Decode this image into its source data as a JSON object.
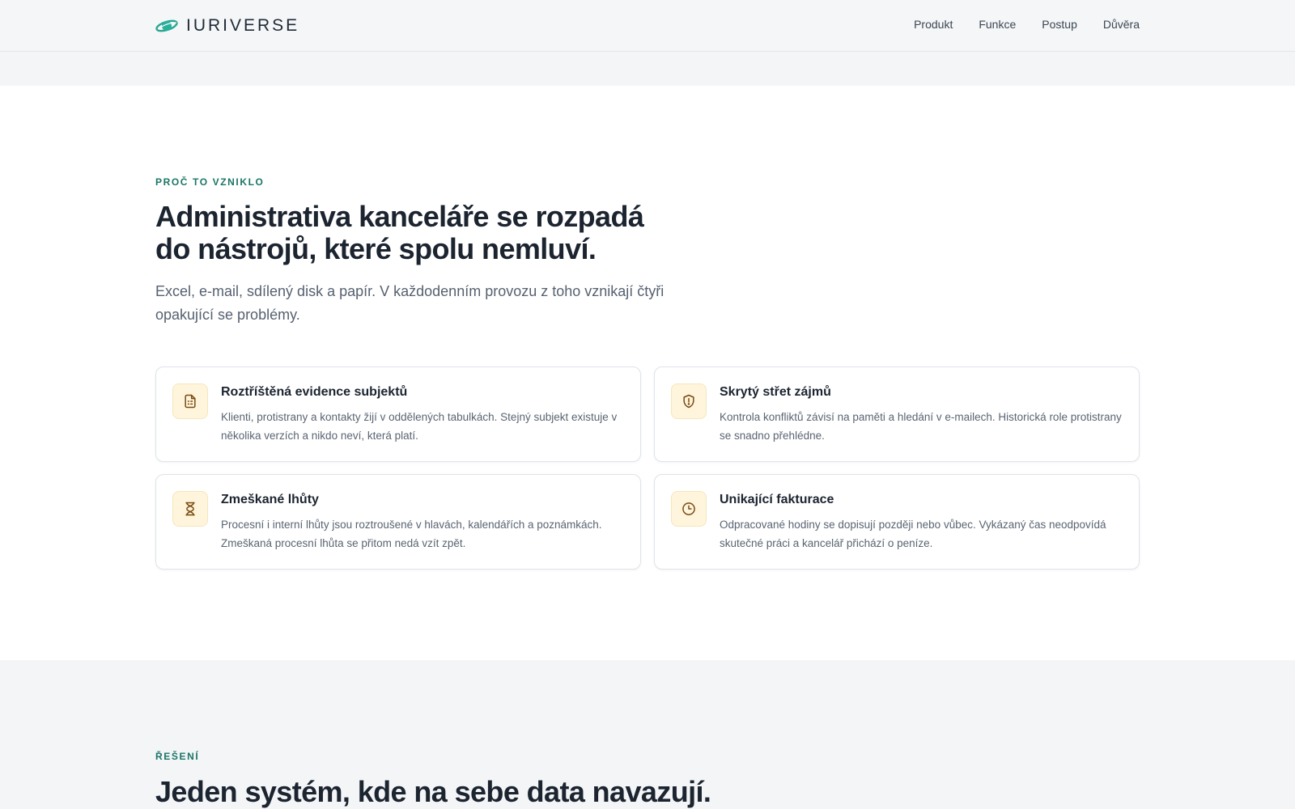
{
  "header": {
    "brand": "IURIVERSE",
    "nav": [
      "Produkt",
      "Funkce",
      "Postup",
      "Důvěra"
    ]
  },
  "problems": {
    "eyebrow": "PROČ TO VZNIKLO",
    "title_line1": "Administrativa kanceláře se rozpadá",
    "title_line2": "do nástrojů, které spolu nemluví.",
    "lead": "Excel, e-mail, sdílený disk a papír. V každodenním provozu z toho vznikají čtyři opakující se problémy.",
    "cards": [
      {
        "icon": "document-icon",
        "title": "Roztříštěná evidence subjektů",
        "desc": "Klienti, protistrany a kontakty žijí v oddělených tabulkách. Stejný subjekt existuje v několika verzích a nikdo neví, která platí."
      },
      {
        "icon": "shield-alert-icon",
        "title": "Skrytý střet zájmů",
        "desc": "Kontrola konfliktů závisí na paměti a hledání v e-mailech. Historická role protistrany se snadno přehlédne."
      },
      {
        "icon": "hourglass-icon",
        "title": "Zmeškané lhůty",
        "desc": "Procesní i interní lhůty jsou roztroušené v hlavách, kalendářích a poznámkách. Zmeškaná procesní lhůta se přitom nedá vzít zpět."
      },
      {
        "icon": "clock-icon",
        "title": "Unikající fakturace",
        "desc": "Odpracované hodiny se dopisují později nebo vůbec. Vykázaný čas neodpovídá skutečné práci a kancelář přichází o peníze."
      }
    ]
  },
  "solution": {
    "eyebrow": "ŘEŠENÍ",
    "title": "Jeden systém, kde na sebe data navazují."
  },
  "colors": {
    "accent": "#1a7565",
    "icon_bg": "#fff5dc",
    "icon_stroke": "#7a4a10"
  }
}
